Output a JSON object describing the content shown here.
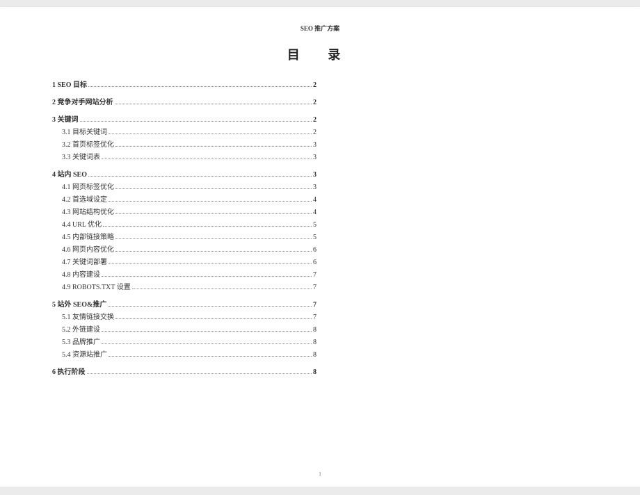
{
  "doc_title": "SEO 推广方案",
  "toc_heading": "目 录",
  "page_number": "1",
  "toc": [
    {
      "level": 1,
      "label": "1 SEO 目标",
      "page": "2"
    },
    {
      "level": 1,
      "label": "2 竞争对手网站分析",
      "page": "2"
    },
    {
      "level": 1,
      "label": "3 关键词",
      "page": "2"
    },
    {
      "level": 2,
      "label": "3.1 目标关键词",
      "page": "2"
    },
    {
      "level": 2,
      "label": "3.2 首页标签优化",
      "page": "3"
    },
    {
      "level": 2,
      "label": "3.3 关键词表",
      "page": "3"
    },
    {
      "level": 1,
      "label": "4 站内 SEO",
      "page": "3"
    },
    {
      "level": 2,
      "label": "4.1 网页标签优化",
      "page": "3"
    },
    {
      "level": 2,
      "label": "4.2 首选域设定",
      "page": "4"
    },
    {
      "level": 2,
      "label": "4.3 网站结构优化",
      "page": "4"
    },
    {
      "level": 2,
      "label": "4.4 URL 优化",
      "page": "5"
    },
    {
      "level": 2,
      "label": "4.5 内部链接策略",
      "page": "5"
    },
    {
      "level": 2,
      "label": "4.6 网页内容优化",
      "page": "6"
    },
    {
      "level": 2,
      "label": "4.7 关键词部署",
      "page": "6"
    },
    {
      "level": 2,
      "label": "4.8 内容建设",
      "page": "7"
    },
    {
      "level": 2,
      "label": "4.9 ROBOTS.TXT 设置",
      "page": "7"
    },
    {
      "level": 1,
      "label": "5 站外 SEO&推广",
      "page": "7"
    },
    {
      "level": 2,
      "label": "5.1 友情链接交换",
      "page": "7"
    },
    {
      "level": 2,
      "label": "5.2 外链建设",
      "page": "8"
    },
    {
      "level": 2,
      "label": "5.3 品牌推广",
      "page": "8"
    },
    {
      "level": 2,
      "label": "5.4 资源站推广",
      "page": "8"
    },
    {
      "level": 1,
      "label": "6 执行阶段",
      "page": "8"
    }
  ]
}
